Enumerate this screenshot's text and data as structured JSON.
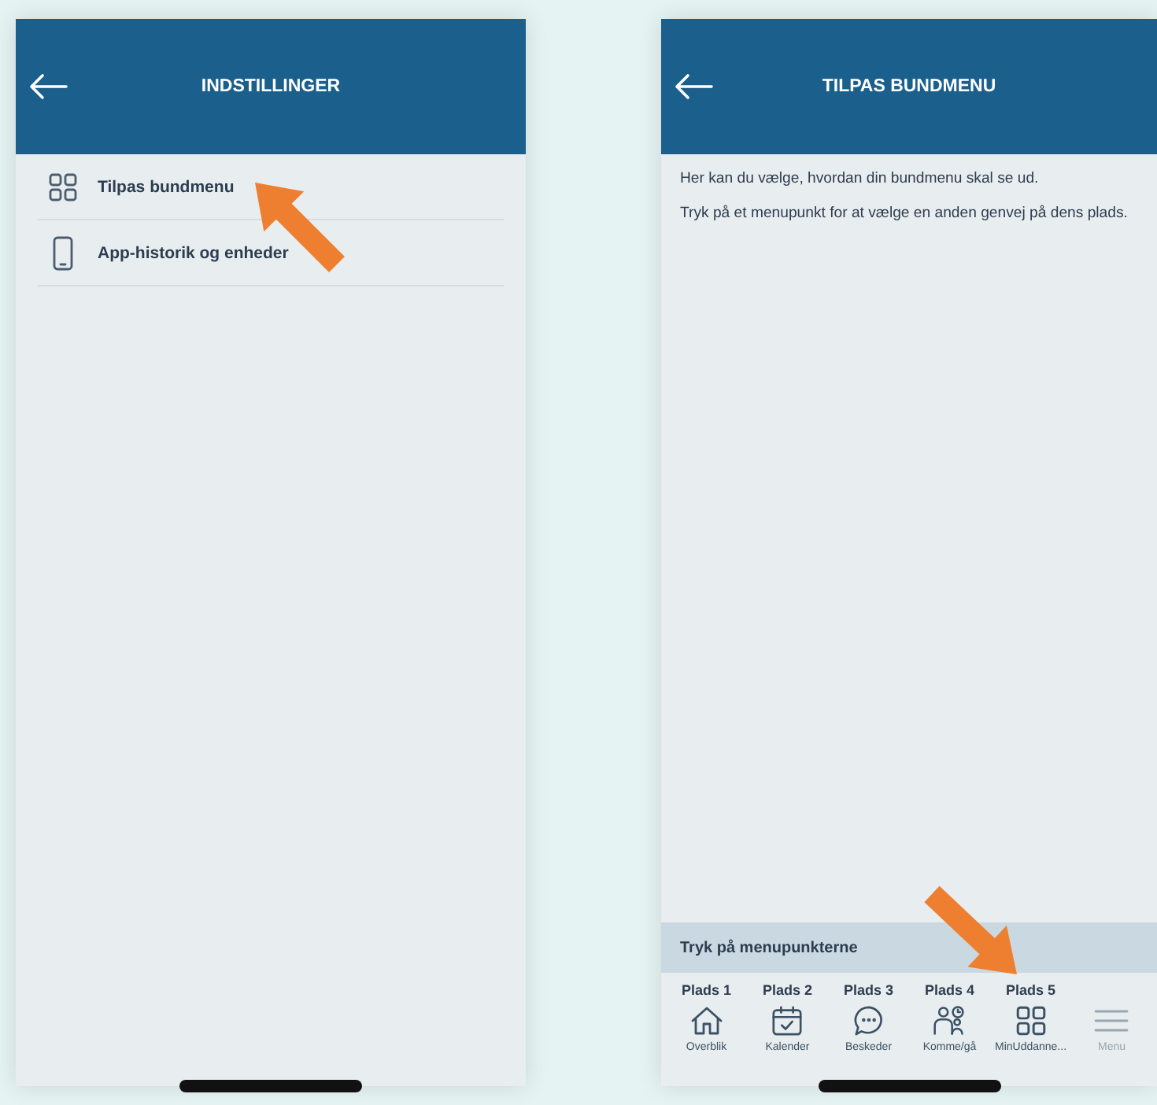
{
  "settings_screen": {
    "title": "INDSTILLINGER",
    "items": [
      {
        "kind": "grid",
        "label": "Tilpas bundmenu"
      },
      {
        "kind": "phone",
        "label": "App-historik og enheder"
      }
    ]
  },
  "customize_screen": {
    "title": "TILPAS BUNDMENU",
    "paragraphs": [
      "Her kan du vælge, hvordan din bundmenu skal se ud.",
      "Tryk på et menupunkt for at vælge en anden genvej på dens plads."
    ],
    "section_header": "Tryk på menupunkterne",
    "slots": [
      "Plads 1",
      "Plads 2",
      "Plads 3",
      "Plads 4",
      "Plads 5"
    ],
    "tabs": [
      {
        "kind": "home",
        "label": "Overblik",
        "disabled": false
      },
      {
        "kind": "calendar",
        "label": "Kalender",
        "disabled": false
      },
      {
        "kind": "chat",
        "label": "Beskeder",
        "disabled": false
      },
      {
        "kind": "people",
        "label": "Komme/gå",
        "disabled": false
      },
      {
        "kind": "grid",
        "label": "MinUddanne...",
        "disabled": false
      },
      {
        "kind": "menu",
        "label": "Menu",
        "disabled": true
      }
    ]
  }
}
